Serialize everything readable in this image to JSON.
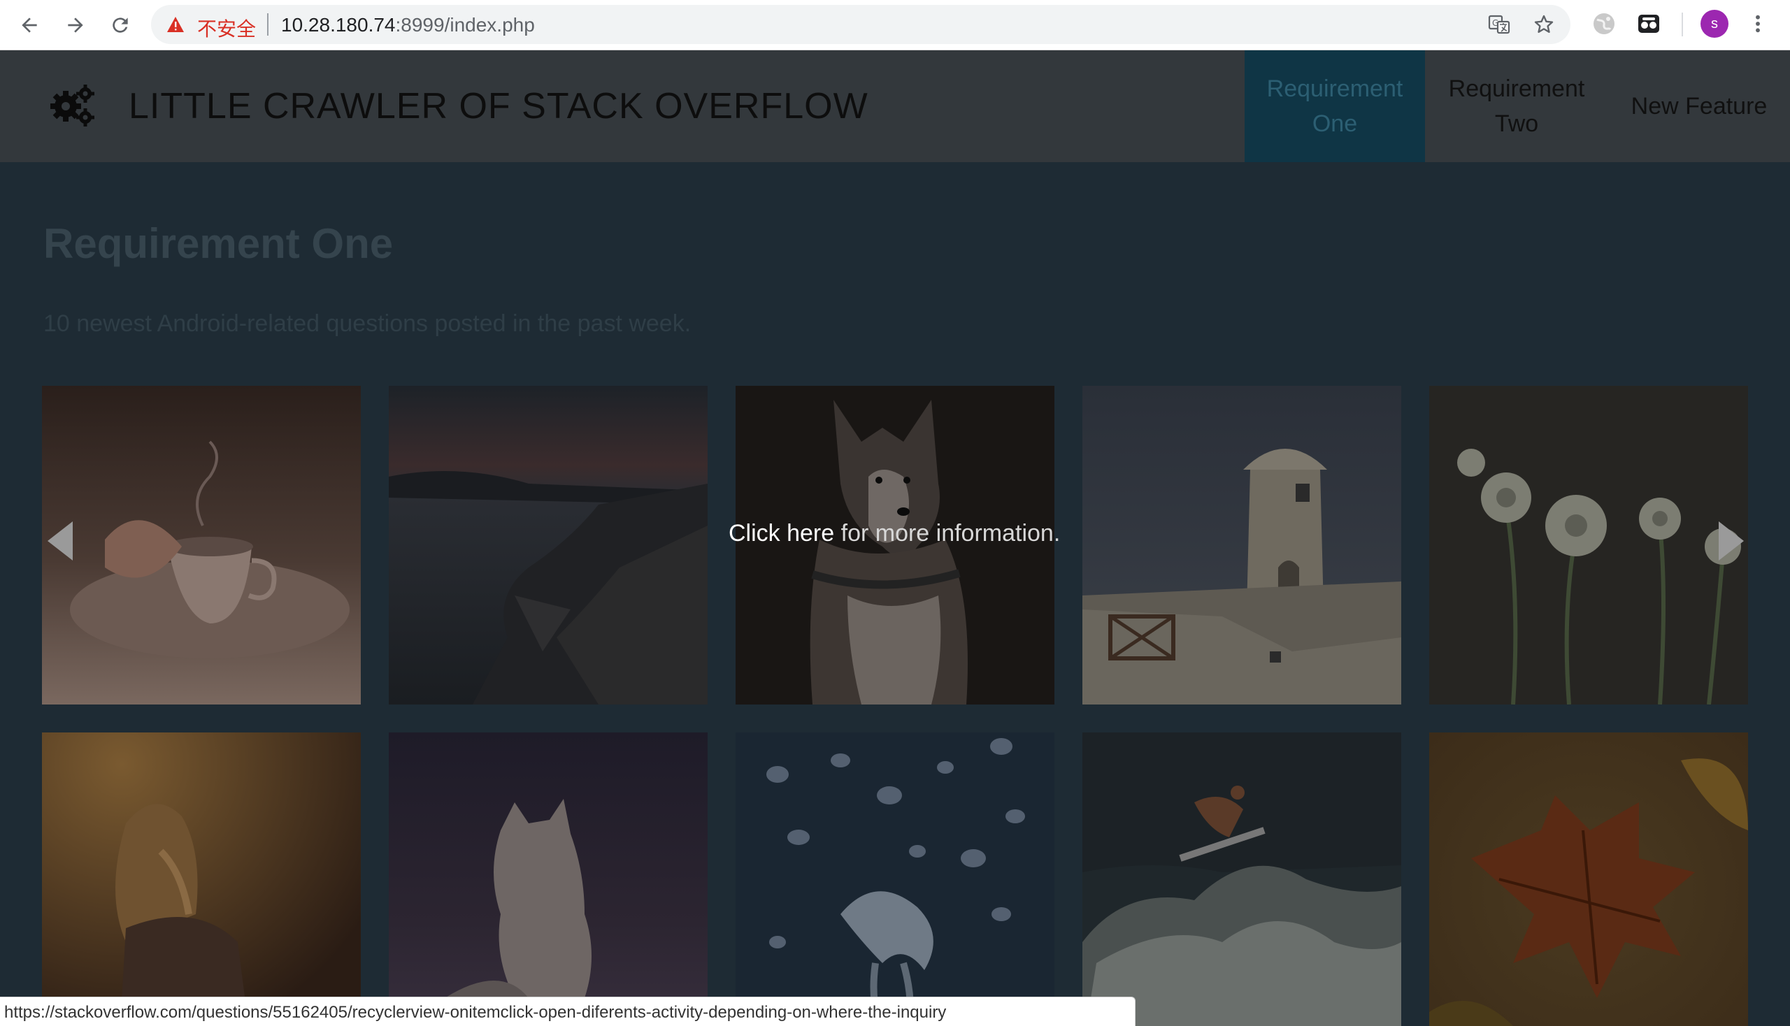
{
  "browser": {
    "security_label": "不安全",
    "url_host": "10.28.180.74",
    "url_rest": ":8999/index.php",
    "avatar_letter": "s",
    "status_url": "https://stackoverflow.com/questions/55162405/recyclerview-onitemclick-open-diferents-activity-depending-on-where-the-inquiry"
  },
  "header": {
    "title": "LITTLE CRAWLER OF STACK OVERFLOW",
    "nav": [
      {
        "label": "Requirement One",
        "active": true
      },
      {
        "label": "Requirement Two",
        "active": false
      },
      {
        "label": "New Feature",
        "active": false
      }
    ]
  },
  "main": {
    "title": "Requirement One",
    "subtitle": "10 newest Android-related questions posted in the past week.",
    "overlay": {
      "link_text": "Click here",
      "rest_text": " for more information."
    },
    "tiles": [
      {
        "subject": "tea-cup-photo"
      },
      {
        "subject": "rocky-coast-photo"
      },
      {
        "subject": "husky-dog-photo"
      },
      {
        "subject": "white-tower-photo"
      },
      {
        "subject": "white-flowers-photo"
      },
      {
        "subject": "woman-sunset-photo"
      },
      {
        "subject": "arctic-fox-photo"
      },
      {
        "subject": "jellyfish-photo"
      },
      {
        "subject": "surfer-wave-photo"
      },
      {
        "subject": "autumn-leaf-photo"
      }
    ]
  }
}
